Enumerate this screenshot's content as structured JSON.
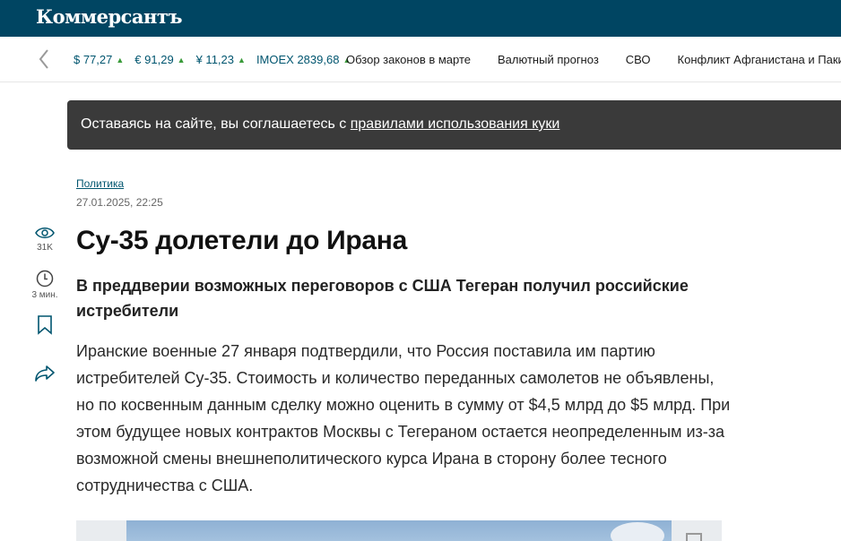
{
  "header": {
    "logo": "Коммерсантъ"
  },
  "ticker": {
    "quotes": [
      {
        "label": "$ 77,27"
      },
      {
        "label": "€ 91,29"
      },
      {
        "label": "¥ 11,23"
      },
      {
        "label": "IMOEX 2839,68"
      }
    ],
    "links": [
      "Обзор законов в марте",
      "Валютный прогноз",
      "СВО",
      "Конфликт Афганистана и Пакистана"
    ]
  },
  "cookie": {
    "text": "Оставаясь на сайте, вы соглашаетесь с ",
    "link": "правилами использования куки"
  },
  "article": {
    "rubric": "Политика",
    "date": "27.01.2025, 22:25",
    "views": "31K",
    "read_time": "3 мин.",
    "title": "Су-35 долетели до Ирана",
    "subtitle": "В преддверии возможных переговоров с США Тегеран получил российские истребители",
    "lead": "Иранские военные 27 января подтвердили, что Россия поставила им партию истребителей Су-35. Стоимость и количество переданных самолетов не объявлены, но по косвенным данным сделку можно оценить в сумму от $4,5 млрд до $5 млрд. При этом будущее новых контрактов Москвы с Тегераном остается неопределенным из-за возможной смены внешнеполитического курса Ирана в сторону более тесного сотрудничества с США."
  },
  "colors": {
    "header_bg": "#004562",
    "accent": "#00556f",
    "up": "#3a9b3a",
    "cookie_bg": "#3a3a3a"
  },
  "icons": [
    "chevron-left-icon",
    "triangle-up-icon",
    "eye-icon",
    "clock-icon",
    "bookmark-icon",
    "share-icon",
    "expand-icon"
  ]
}
